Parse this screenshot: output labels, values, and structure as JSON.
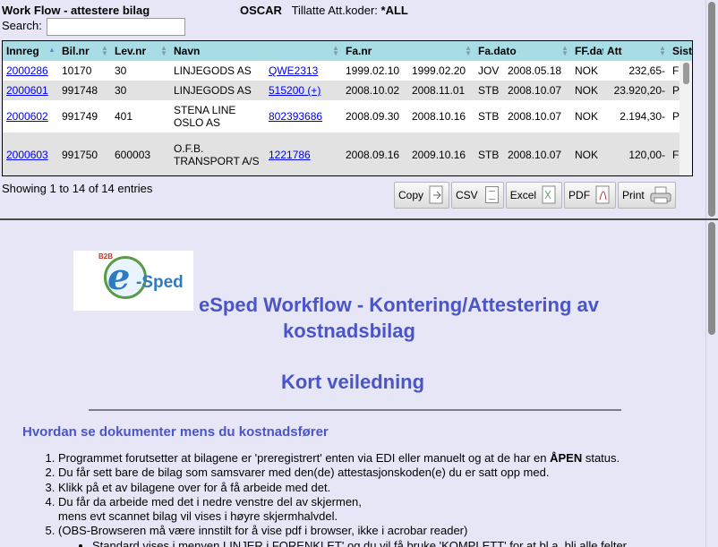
{
  "header": {
    "title": "Work Flow - attestere bilag",
    "user": "OSCAR",
    "codes_label": "Tillatte Att.koder:",
    "codes_value": "*ALL",
    "search_label": "Search:",
    "search_value": "",
    "search_placeholder": ""
  },
  "table": {
    "columns": [
      "Innreg",
      "Bil.nr",
      "Lev.nr",
      "Navn",
      "",
      "Fa.nr",
      "",
      "Fa.dato",
      "FF.dato",
      "",
      "Att",
      "Sist e"
    ],
    "rows": [
      {
        "innreg": "2000286",
        "bilnr": "10170",
        "levnr": "30",
        "navn": "LINJEGODS AS",
        "ref": "QWE2313",
        "fanr": "1999.02.10",
        "date2": "1999.02.20",
        "kode": "JOV",
        "fadato": "2008.05.18",
        "cur": "NOK",
        "att": "232,65-",
        "flag": "F"
      },
      {
        "innreg": "2000601",
        "bilnr": "991748",
        "levnr": "30",
        "navn": "LINJEGODS AS",
        "ref": "515200 (+)",
        "fanr": "2008.10.02",
        "date2": "2008.11.01",
        "kode": "STB",
        "fadato": "2008.10.07",
        "cur": "NOK",
        "att": "23.920,20-",
        "flag": "P"
      },
      {
        "innreg": "2000602",
        "bilnr": "991749",
        "levnr": "401",
        "navn": "STENA LINE OSLO AS",
        "ref": "802393686",
        "fanr": "2008.09.30",
        "date2": "2008.10.16",
        "kode": "STB",
        "fadato": "2008.10.07",
        "cur": "NOK",
        "att": "2.194,30-",
        "flag": "P"
      },
      {
        "innreg": "2000603",
        "bilnr": "991750",
        "levnr": "600003",
        "navn": "O.F.B. TRANSPORT A/S",
        "ref": "1221786",
        "fanr": "2008.09.16",
        "date2": "2009.10.16",
        "kode": "STB",
        "fadato": "2008.10.07",
        "cur": "NOK",
        "att": "120,00-",
        "flag": "F"
      }
    ],
    "info": "Showing 1 to 14 of 14 entries"
  },
  "toolbar": {
    "buttons": [
      {
        "label": "Copy",
        "icon": "copy-icon"
      },
      {
        "label": "CSV",
        "icon": "csv-icon"
      },
      {
        "label": "Excel",
        "icon": "excel-icon"
      },
      {
        "label": "PDF",
        "icon": "pdf-icon"
      },
      {
        "label": "Print",
        "icon": "printer-icon"
      }
    ]
  },
  "guide": {
    "logo_text": "-Sped",
    "logo_badge": "B2B",
    "title_line1": "eSped Workflow - Kontering/Attestering av",
    "title_line2": "kostnadsbilag",
    "subtitle": "Kort veiledning",
    "section_heading": "Hvordan se dokumenter mens du kostnadsfører",
    "steps": [
      "Programmet forutsetter at bilagene er 'preregistrert' enten via EDI eller manuelt og at de har en ÅPEN status.",
      "Du får sett bare de bilag som samsvarer med den(de) attestasjonskoden(e) du er satt opp med.",
      "Klikk på et av bilagene over for å få arbeide med det.",
      "Du får da arbeide med det i nedre venstre del av skjermen,",
      "(OBS-Browseren må være innstilt for å vise pdf i browser, ikke i acrobar reader)"
    ],
    "step4_cont": "mens evt scannet bilag vil vises i høyre skjermhalvdel.",
    "step5_sub": "Standard vises i menyen LINJER i FORENKLET' og du vil få bruke 'KOMPLETT' for at bl.a. bli alle felter"
  },
  "colors": {
    "background": "#e6e6f7",
    "table_header": "#a8dde5",
    "heading_blue": "#4a55c6",
    "link": "#0000ee"
  }
}
